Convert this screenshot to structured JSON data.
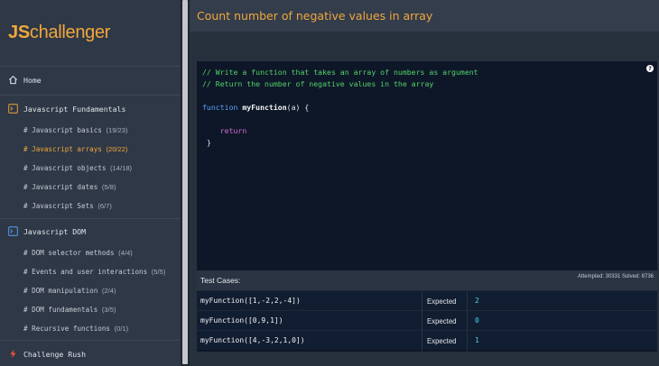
{
  "logo": {
    "js": "JS",
    "rest": "challenger"
  },
  "sidebar": {
    "home": "Home",
    "sections": [
      {
        "label": "Javascript Fundamentals",
        "items": [
          {
            "label": "# Javascript basics",
            "count": "(19/23)"
          },
          {
            "label": "# Javascript arrays",
            "count": "(20/22)"
          },
          {
            "label": "# Javascript objects",
            "count": "(14/18)"
          },
          {
            "label": "# Javascript dates",
            "count": "(5/8)"
          },
          {
            "label": "# Javascript Sets",
            "count": "(6/7)"
          }
        ]
      },
      {
        "label": "Javascript DOM",
        "items": [
          {
            "label": "# DOM selector methods",
            "count": "(4/4)"
          },
          {
            "label": "# Events and user interactions",
            "count": "(5/5)"
          },
          {
            "label": "# DOM manipulation",
            "count": "(2/4)"
          },
          {
            "label": "# DOM fundamentals",
            "count": "(3/5)"
          },
          {
            "label": "# Recursive functions",
            "count": "(0/1)"
          }
        ]
      }
    ],
    "challenge_rush": "Challenge Rush",
    "active_item": "# Javascript arrays"
  },
  "challenge": {
    "title": "Count number of negative values in array",
    "code": {
      "comment1": "// Write a function that takes an array of numbers as argument",
      "comment2": "// Return the number of negative values in the array",
      "keyword_function": "function",
      "fn_name": "myFunction",
      "params": "(a) {",
      "keyword_return": "return",
      "close_brace": "}"
    },
    "help_icon": "?"
  },
  "tests": {
    "title": "Test Cases:",
    "stats": "Attempted: 30331   Solved: 8736",
    "expected_label": "Expected",
    "cases": [
      {
        "call": "myFunction([1,-2,2,-4])",
        "expected": "2"
      },
      {
        "call": "myFunction([0,9,1])",
        "expected": "0"
      },
      {
        "call": "myFunction([4,-3,2,1,0])",
        "expected": "1"
      }
    ]
  },
  "colors": {
    "accent": "#f2a73b",
    "sidebar_bg": "#2e3846",
    "editor_bg": "#0e1727",
    "comment": "#53d16a",
    "keyword": "#5aa2f5",
    "return_kw": "#d66ad8",
    "expected_value": "#4bd0e6"
  }
}
